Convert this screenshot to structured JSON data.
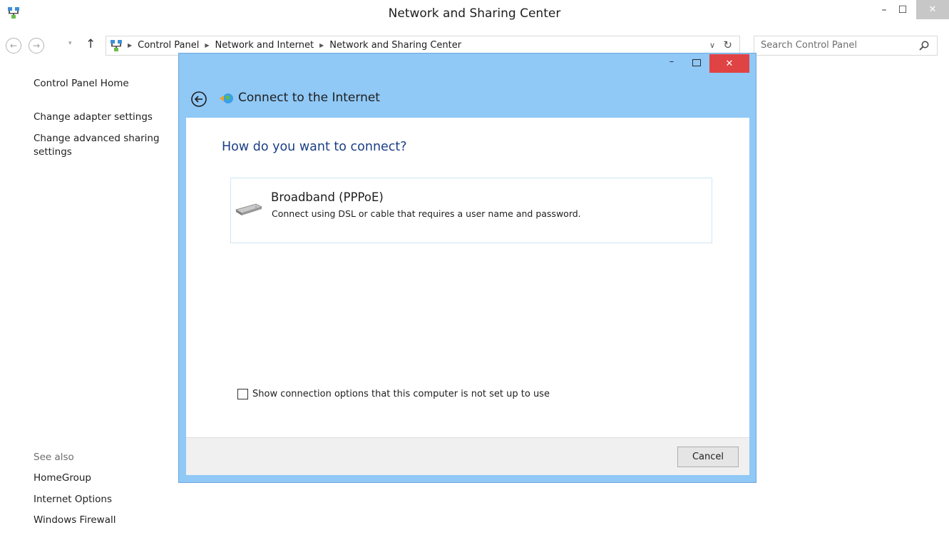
{
  "window": {
    "title": "Network and Sharing Center",
    "minimize_glyph": "–",
    "maximize_glyph": "☐",
    "close_glyph": "✕"
  },
  "nav": {
    "back_glyph": "←",
    "forward_glyph": "→",
    "recent_glyph": "▾",
    "up_glyph": "↑"
  },
  "address": {
    "crumbs": [
      "Control Panel",
      "Network and Internet",
      "Network and Sharing Center"
    ],
    "sep_glyph": "▶",
    "dropdown_glyph": "∨",
    "refresh_glyph": "↻"
  },
  "search": {
    "placeholder": "Search Control Panel"
  },
  "leftpane": {
    "home": "Control Panel Home",
    "adapter": "Change adapter settings",
    "advanced_line1": "Change advanced sharing",
    "advanced_line2": "settings",
    "see_also": "See also",
    "homegroup": "HomeGroup",
    "internet_options": "Internet Options",
    "firewall": "Windows Firewall"
  },
  "dialog": {
    "title": "Connect to the Internet",
    "minimize_glyph": "–",
    "close_glyph": "✕",
    "question": "How do you want to connect?",
    "option_title": "Broadband (PPPoE)",
    "option_desc": "Connect using DSL or cable that requires a user name and password.",
    "checkbox_label": "Show connection options that this computer is not set up to use",
    "checkbox_checked": false,
    "cancel_label": "Cancel"
  },
  "colors": {
    "dialog_frame": "#90c8f6",
    "dialog_close": "#e04343",
    "heading_blue": "#1b3f86"
  },
  "icons": {
    "app": "network-icon",
    "back": "back-arrow-icon",
    "connection": "connect-globe-icon",
    "modem": "modem-icon",
    "search": "search-icon"
  }
}
